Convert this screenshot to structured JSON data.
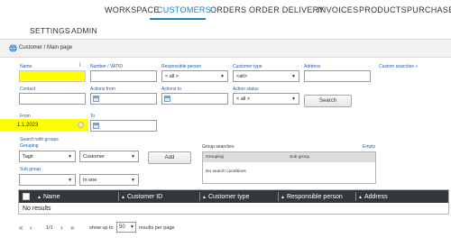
{
  "topnav": {
    "items": [
      {
        "label": "WORKSPACE"
      },
      {
        "label": "CUSTOMERS"
      },
      {
        "label": "ORDERS"
      },
      {
        "label": "ORDER DELIVERY"
      },
      {
        "label": "INVOICES"
      },
      {
        "label": "PRODUCTS"
      },
      {
        "label": "PURCHASES"
      }
    ],
    "active": "CUSTOMERS",
    "accent_color": "#1f7fbf"
  },
  "subnav": {
    "items": [
      {
        "label": "SETTINGS"
      },
      {
        "label": "ADMIN"
      }
    ]
  },
  "breadcrumb": {
    "text": "Customer / Main page",
    "icon": "globe-icon"
  },
  "search_form": {
    "name": {
      "label": "Name",
      "value": "",
      "highlight": "#ffff00",
      "info_icon": "i"
    },
    "number_vatid": {
      "label": "Number / VATID",
      "value": ""
    },
    "responsible_person": {
      "label": "Responsible person",
      "selected": "< all >"
    },
    "customer_type": {
      "label": "Customer type",
      "selected": "<all>"
    },
    "address": {
      "label": "Address",
      "value": ""
    },
    "custom_searches": {
      "label": "Custom searches »"
    },
    "contact": {
      "label": "Contact",
      "value": ""
    },
    "actions_from": {
      "label": "Actions from",
      "value": ""
    },
    "actions_to": {
      "label": "Actions to",
      "value": ""
    },
    "action_status": {
      "label": "Action status",
      "selected": "< all >"
    },
    "search_button": "Search",
    "from": {
      "label": "From",
      "value": "1.1.2023"
    },
    "to": {
      "label": "To",
      "value": ""
    },
    "search_with_groups": "Search with groups",
    "grouping": {
      "label": "Grouping",
      "selected": "Tagit"
    },
    "grouping_target": {
      "selected": "Customer"
    },
    "add_button": "Add",
    "sub_group": {
      "label": "Sub group",
      "selected": ""
    },
    "sub_group_mode": {
      "selected": "In one"
    }
  },
  "group_searches": {
    "title": "Group searches",
    "empty_link": "Empty",
    "columns": [
      "Grouping",
      "Sub group"
    ],
    "empty_text": "No search conditions"
  },
  "results": {
    "columns": [
      "Name",
      "Customer ID",
      "Customer type",
      "Responsible person",
      "Address"
    ],
    "empty_text": "No results",
    "header_color": "#33373d"
  },
  "pager": {
    "first": "«",
    "prev": "‹",
    "page": "1/1",
    "next": "›",
    "last": "»",
    "show_up_to": "show up to",
    "page_size": "50",
    "results_per_page": "results per page"
  }
}
